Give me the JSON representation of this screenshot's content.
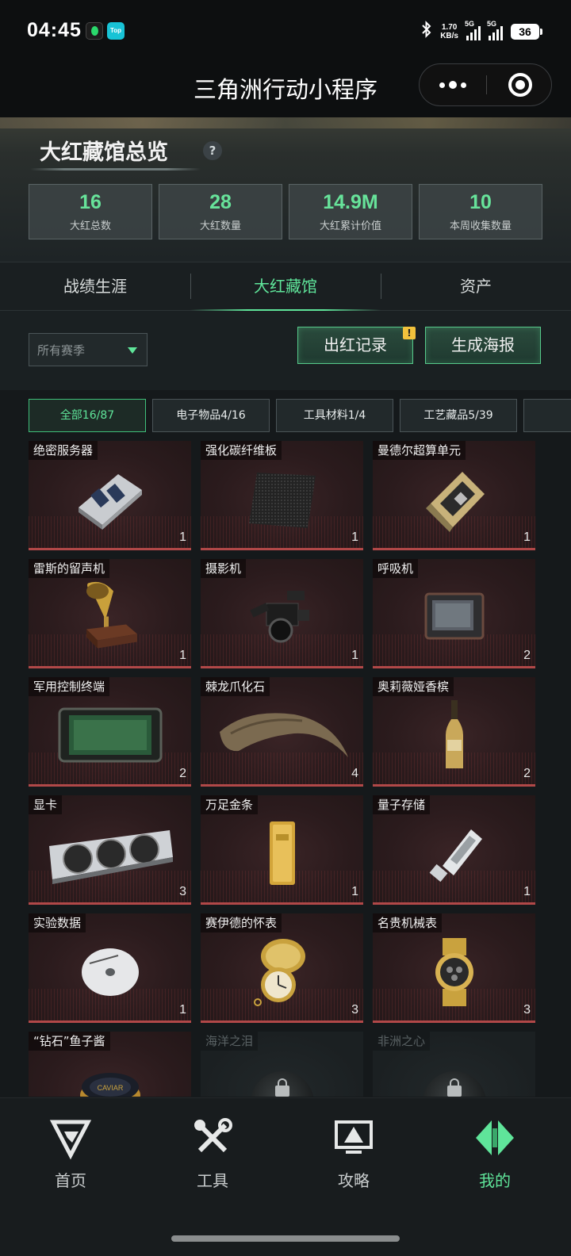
{
  "status_bar": {
    "time": "04:45",
    "app_badge": "Top",
    "net_speed": "1.70",
    "net_speed_unit": "KB/s",
    "sim1": "5G",
    "sim2": "5G",
    "battery": "36"
  },
  "title_bar": {
    "title": "三角洲行动小程序"
  },
  "overview": {
    "title": "大红藏馆总览",
    "help": "?",
    "stats": [
      {
        "value": "16",
        "label": "大红总数"
      },
      {
        "value": "28",
        "label": "大红数量"
      },
      {
        "value": "14.9M",
        "label": "大红累计价值"
      },
      {
        "value": "10",
        "label": "本周收集数量"
      }
    ]
  },
  "tabs": [
    {
      "label": "战绩生涯",
      "active": false
    },
    {
      "label": "大红藏馆",
      "active": true
    },
    {
      "label": "资产",
      "active": false
    }
  ],
  "toolbar": {
    "season_placeholder": "所有赛季",
    "record_button": "出红记录",
    "record_badge": "!",
    "poster_button": "生成海报"
  },
  "categories": [
    {
      "label": "全部16/87",
      "active": true
    },
    {
      "label": "电子物品4/16",
      "active": false
    },
    {
      "label": "工具材料1/4",
      "active": false
    },
    {
      "label": "工艺藏品5/39",
      "active": false
    }
  ],
  "items": [
    {
      "name": "绝密服务器",
      "count": "1",
      "icon": "server"
    },
    {
      "name": "强化碳纤维板",
      "count": "1",
      "icon": "carbon-plate"
    },
    {
      "name": "曼德尔超算单元",
      "count": "1",
      "icon": "supercomputer-chip"
    },
    {
      "name": "雷斯的留声机",
      "count": "1",
      "icon": "gramophone"
    },
    {
      "name": "摄影机",
      "count": "1",
      "icon": "camera"
    },
    {
      "name": "呼吸机",
      "count": "2",
      "icon": "ventilator"
    },
    {
      "name": "军用控制终端",
      "count": "2",
      "icon": "tablet"
    },
    {
      "name": "棘龙爪化石",
      "count": "4",
      "icon": "claw-fossil"
    },
    {
      "name": "奥莉薇娅香槟",
      "count": "2",
      "icon": "champagne"
    },
    {
      "name": "显卡",
      "count": "3",
      "icon": "graphics-card"
    },
    {
      "name": "万足金条",
      "count": "1",
      "icon": "gold-bar"
    },
    {
      "name": "量子存储",
      "count": "1",
      "icon": "usb-drive"
    },
    {
      "name": "实验数据",
      "count": "1",
      "icon": "disc"
    },
    {
      "name": "赛伊德的怀表",
      "count": "3",
      "icon": "pocket-watch"
    },
    {
      "name": "名贵机械表",
      "count": "3",
      "icon": "wristwatch"
    },
    {
      "name": "“钻石”鱼子酱",
      "count": "",
      "icon": "caviar",
      "icon_text": "CAVIAR"
    },
    {
      "name": "海洋之泪",
      "count": "",
      "icon": "lock",
      "locked": true
    },
    {
      "name": "非洲之心",
      "count": "",
      "icon": "lock",
      "locked": true
    }
  ],
  "bottom_nav": [
    {
      "label": "首页",
      "active": false
    },
    {
      "label": "工具",
      "active": false
    },
    {
      "label": "攻略",
      "active": false
    },
    {
      "label": "我的",
      "active": true
    }
  ],
  "colors": {
    "accent": "#5fe59a",
    "card_red": "#b14848",
    "background": "#15191b"
  }
}
